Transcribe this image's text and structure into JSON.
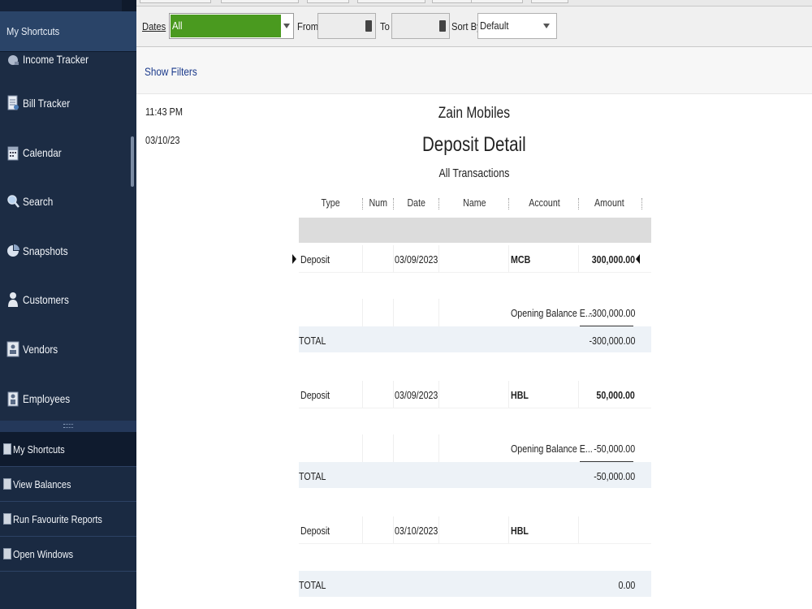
{
  "sidebar": {
    "header": "My Shortcuts",
    "items": [
      {
        "label": "Income Tracker",
        "icon": "income-tracker-icon"
      },
      {
        "label": "Bill Tracker",
        "icon": "bill-tracker-icon"
      },
      {
        "label": "Calendar",
        "icon": "calendar-icon"
      },
      {
        "label": "Search",
        "icon": "search-icon"
      },
      {
        "label": "Snapshots",
        "icon": "snapshots-icon"
      },
      {
        "label": "Customers",
        "icon": "customers-icon"
      },
      {
        "label": "Vendors",
        "icon": "vendors-icon"
      },
      {
        "label": "Employees",
        "icon": "employees-icon"
      }
    ],
    "bottom": [
      {
        "label": "My Shortcuts",
        "active": true
      },
      {
        "label": "View Balances"
      },
      {
        "label": "Run Favourite Reports"
      },
      {
        "label": "Open Windows"
      }
    ]
  },
  "filters": {
    "dates_label": "Dates",
    "dates_value": "All",
    "from_label": "From",
    "from_value": "",
    "to_label": "To",
    "to_value": "",
    "sort_label": "Sort By",
    "sort_value": "Default",
    "show_filters": "Show Filters"
  },
  "report": {
    "time": "11:43 PM",
    "date": "03/10/23",
    "company": "Zain Mobiles",
    "title": "Deposit Detail",
    "subtitle": "All Transactions",
    "columns": [
      "Type",
      "Num",
      "Date",
      "Name",
      "Account",
      "Amount"
    ],
    "groups": [
      {
        "deposit": {
          "type": "Deposit",
          "num": "",
          "date": "03/09/2023",
          "name": "",
          "account": "MCB",
          "amount": "300,000.00"
        },
        "split": {
          "account": "Opening Balance E...",
          "amount": "-300,000.00"
        },
        "total": {
          "label": "TOTAL",
          "amount": "-300,000.00"
        }
      },
      {
        "deposit": {
          "type": "Deposit",
          "num": "",
          "date": "03/09/2023",
          "name": "",
          "account": "HBL",
          "amount": "50,000.00"
        },
        "split": {
          "account": "Opening Balance E...",
          "amount": "-50,000.00"
        },
        "total": {
          "label": "TOTAL",
          "amount": "-50,000.00"
        }
      },
      {
        "deposit": {
          "type": "Deposit",
          "num": "",
          "date": "03/10/2023",
          "name": "",
          "account": "HBL",
          "amount": ""
        },
        "total": {
          "label": "TOTAL",
          "amount": "0.00"
        }
      }
    ]
  },
  "colors": {
    "sidebar_bg": "#1c2c44",
    "dates_highlight": "#4a9a1f",
    "link": "#1c3b8c",
    "total_row_bg": "#edf2f7"
  }
}
